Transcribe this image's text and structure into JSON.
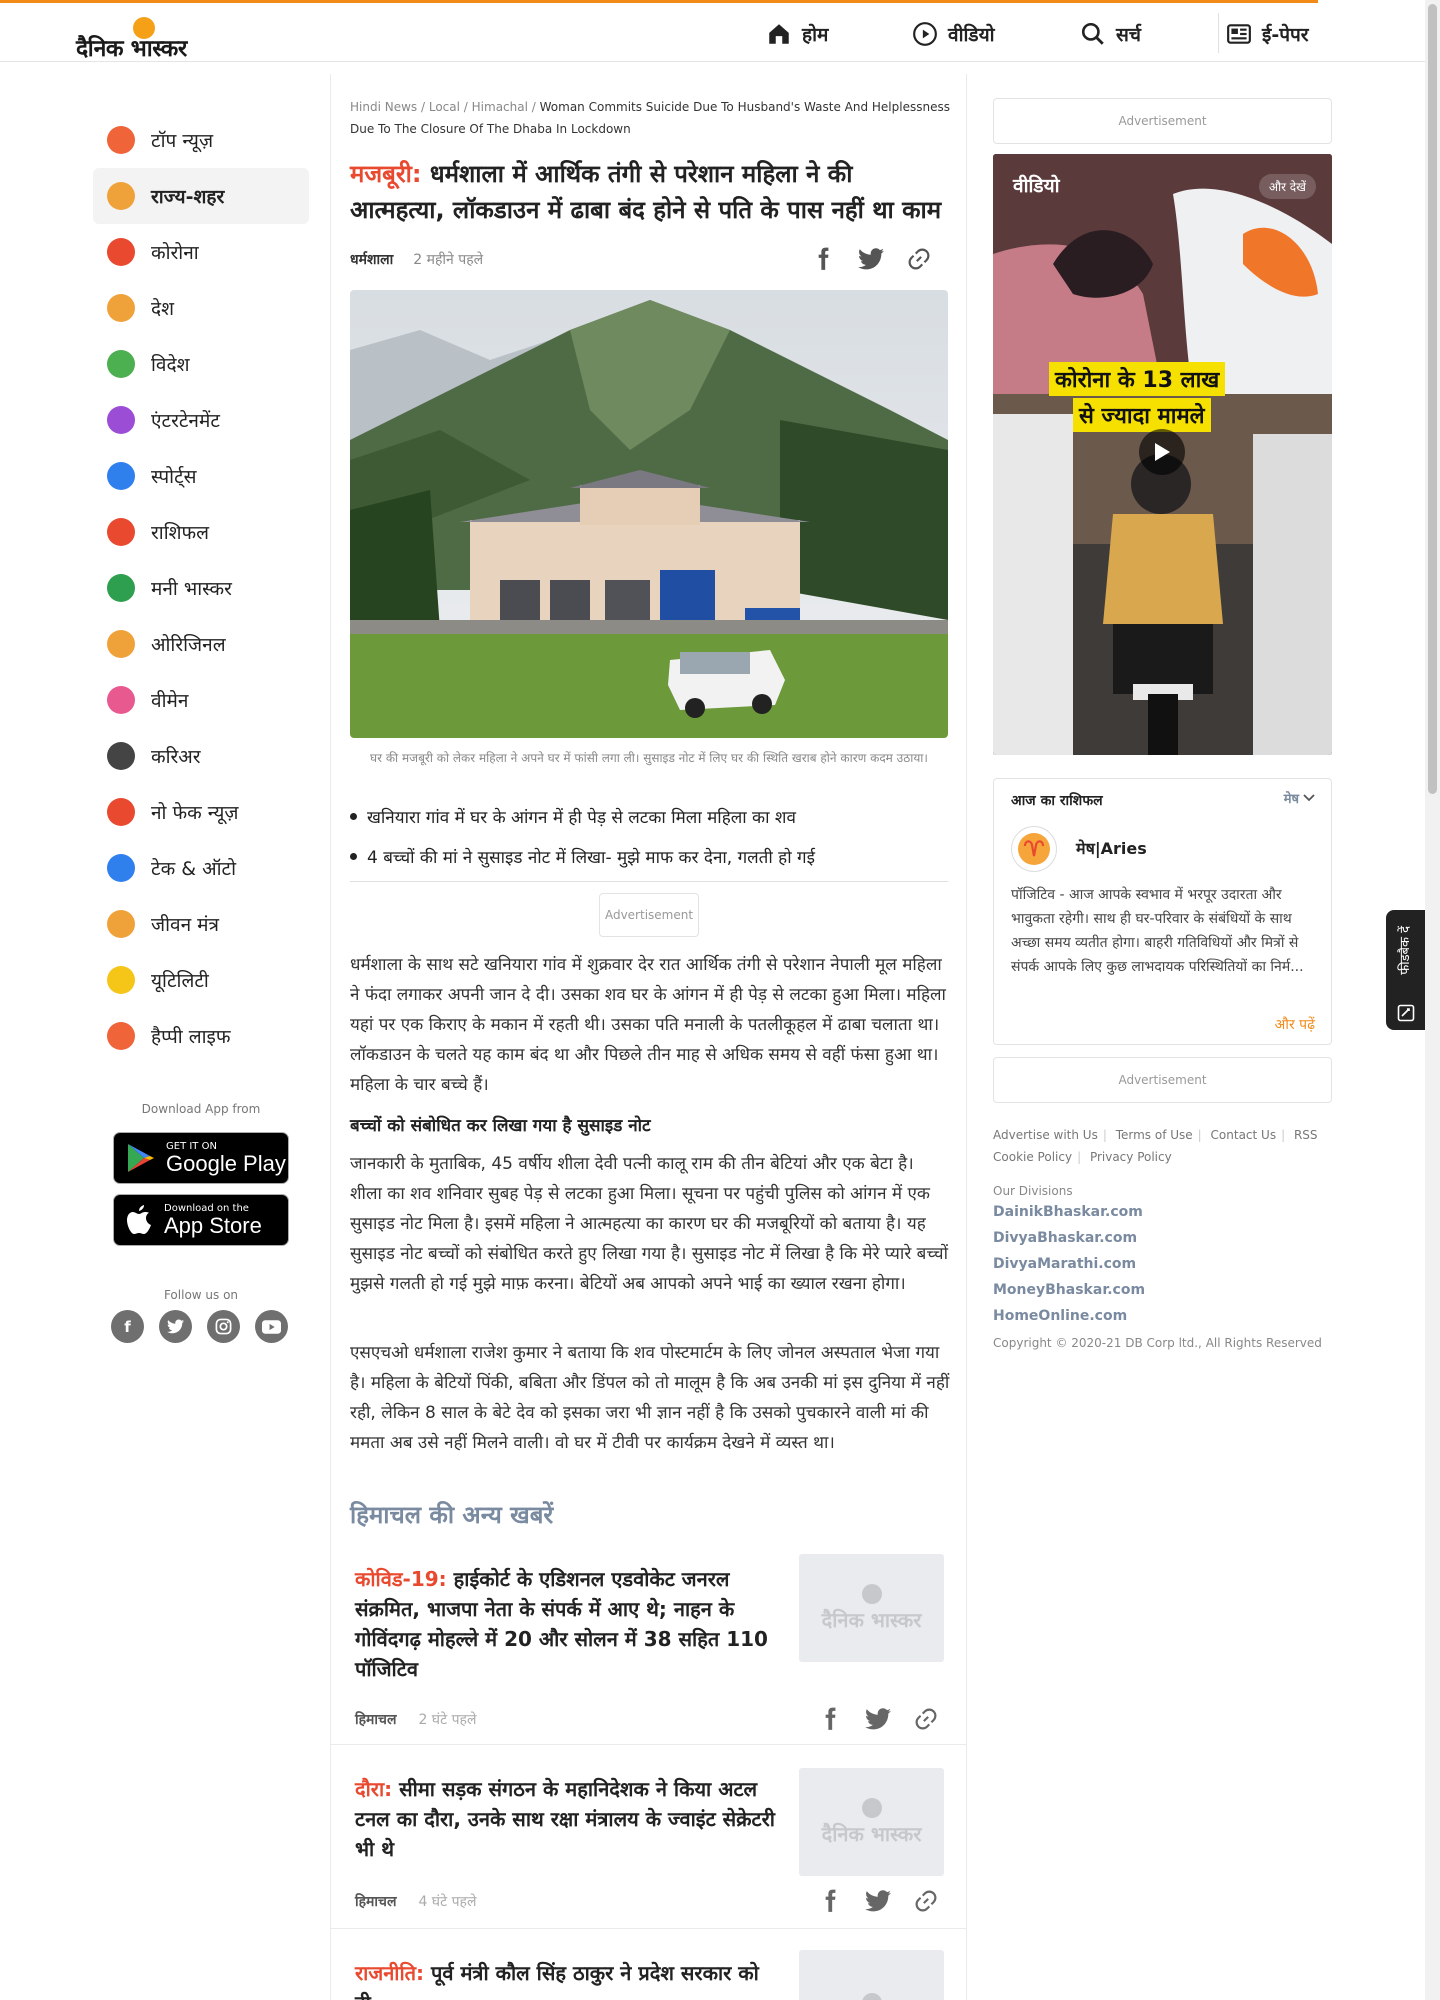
{
  "brand": {
    "logo_text": "दैनिक भास्कर"
  },
  "nav": [
    {
      "label": "होम",
      "icon": "home-icon"
    },
    {
      "label": "वीडियो",
      "icon": "play-icon"
    },
    {
      "label": "सर्च",
      "icon": "search-icon"
    },
    {
      "label": "ई-पेपर",
      "icon": "newspaper-icon"
    }
  ],
  "sidebar": {
    "items": [
      {
        "label": "टॉप न्यूज़",
        "icon": "flame-icon",
        "color": "#f0643a"
      },
      {
        "label": "राज्य-शहर",
        "icon": "city-icon",
        "color": "#f0a23a",
        "active": true
      },
      {
        "label": "कोरोना",
        "icon": "virus-icon",
        "color": "#e8492f"
      },
      {
        "label": "देश",
        "icon": "india-gate-icon",
        "color": "#f0a23a"
      },
      {
        "label": "विदेश",
        "icon": "globe-icon",
        "color": "#4caf50"
      },
      {
        "label": "एंटरटेनमेंट",
        "icon": "clapper-icon",
        "color": "#9c4dd6"
      },
      {
        "label": "स्पोर्ट्स",
        "icon": "runner-icon",
        "color": "#2f80ed"
      },
      {
        "label": "राशिफल",
        "icon": "zodiac-icon",
        "color": "#e8492f"
      },
      {
        "label": "मनी भास्कर",
        "icon": "rupee-icon",
        "color": "#2e9e4f"
      },
      {
        "label": "ओरिजिनल",
        "icon": "original-icon",
        "color": "#f0a23a"
      },
      {
        "label": "वीमेन",
        "icon": "women-icon",
        "color": "#e85a8f"
      },
      {
        "label": "करिअर",
        "icon": "graduation-cap-icon",
        "color": "#444444"
      },
      {
        "label": "नो फेक न्यूज़",
        "icon": "no-fake-icon",
        "color": "#e8492f"
      },
      {
        "label": "टेक & ऑटो",
        "icon": "tech-auto-icon",
        "color": "#2f80ed"
      },
      {
        "label": "जीवन मंत्र",
        "icon": "kalash-icon",
        "color": "#f0a23a"
      },
      {
        "label": "यूटिलिटी",
        "icon": "bulb-icon",
        "color": "#f5c518"
      },
      {
        "label": "हैप्पी लाइफ",
        "icon": "heart-hands-icon",
        "color": "#f0643a"
      }
    ],
    "download_label": "Download App from",
    "google_play": {
      "small": "GET IT ON",
      "big": "Google Play"
    },
    "app_store": {
      "small": "Download on the",
      "big": "App Store"
    },
    "follow_label": "Follow us on",
    "socials": [
      "facebook-icon",
      "twitter-icon",
      "instagram-icon",
      "youtube-icon"
    ]
  },
  "article": {
    "breadcrumb": [
      "Hindi News",
      "Local",
      "Himachal"
    ],
    "breadcrumb_current": "Woman Commits Suicide Due To Husband's Waste And Helplessness Due To The Closure Of The Dhaba In Lockdown",
    "kicker": "मजबूरी:",
    "headline": "धर्मशाला में आर्थिक तंगी से परेशान महिला ने की आत्महत्या, लॉकडाउन में ढाबा बंद होने से पति के पास नहीं था काम",
    "location": "धर्मशाला",
    "time": "2 महीने पहले",
    "caption": "घर की मजबूरी को लेकर महिला ने अपने घर में फांसी लगा ली। सुसाइड नोट में लिए घर की स्थिति खराब होने कारण कदम उठाया।",
    "bullets": [
      "खनियारा गांव में घर के आंगन में ही पेड़ से लटका मिला महिला का शव",
      "4 बच्चों की मां ने सुसाइड नोट में लिखा- मुझे माफ कर देना, गलती हो गई"
    ],
    "ad_label": "Advertisement",
    "paragraphs": [
      "धर्मशाला के साथ सटे खनियारा गांव में शुक्रवार देर रात आर्थिक तंगी से परेशान नेपाली मूल महिला ने फंदा लगाकर अपनी जान दे दी। उसका शव घर के आंगन में ही पेड़ से लटका हुआ मिला। महिला यहां पर एक किराए के मकान में रहती थी। उसका पति मनाली के पतलीकूहल में ढाबा चलाता था। लॉकडाउन के चलते यह काम बंद था और पिछले तीन माह से अधिक समय से वहीं फंसा हुआ था। महिला के चार बच्चे हैं।",
      "जानकारी के मुताबिक, 45 वर्षीय शीला देवी पत्नी कालू राम की तीन बेटियां और एक बेटा है। शीला का शव शनिवार सुबह पेड़ से लटका हुआ मिला। सूचना पर पहुंची पुलिस को आंगन में एक सुसाइड नोट मिला है। इसमें महिला ने आत्महत्या का कारण घर की मजबूरियों को बताया है। यह सुसाइड नोट बच्चों को संबोधित करते हुए लिखा गया है। सुसाइड नोट में लिखा है कि मेरे प्यारे बच्चों मुझसे गलती हो गई मुझे माफ़ करना। बेटियों अब आपको अपने भाई का ख्याल रखना होगा।",
      "एसएचओ धर्मशाला राजेश कुमार ने बताया कि शव पोस्टमार्टम के लिए जोनल अस्पताल भेजा गया है। महिला के बेटियों पिंकी, बबिता और डिंपल को तो मालूम है कि अब उनकी मां इस दुनिया में नहीं रही, लेकिन 8 साल के बेटे देव को इसका जरा भी ज्ञान नहीं है कि उसको पुचकारने वाली मां की ममता अब उसे नहीं मिलने वाली। वो घर में टीवी पर कार्यक्रम देखने में व्यस्त था।"
    ],
    "subhead": "बच्चों को संबोधित कर लिखा गया है सुसाइड नोट"
  },
  "more_news": {
    "title": "हिमाचल की अन्य खबरें",
    "thumb_text": "दैनिक भास्कर",
    "stories": [
      {
        "kicker": "कोविड-19:",
        "title": "हाईकोर्ट के एडिशनल एडवोकेट जनरल संक्रमित, भाजपा नेता के संपर्क में आए थे; नाहन के गोविंदगढ़ मोहल्ले में 20 और सोलन में 38 सहित 110 पॉजिटिव",
        "location": "हिमाचल",
        "time": "2 घंटे पहले"
      },
      {
        "kicker": "दौरा:",
        "title": "सीमा सड़क संगठन के महानिदेशक ने किया अटल टनल का दौरा, उनके साथ रक्षा मंत्रालय के ज्वाइंट सेक्रेटरी भी थे",
        "location": "हिमाचल",
        "time": "4 घंटे पहले"
      },
      {
        "kicker": "राजनीति:",
        "title": "पूर्व मंत्री कौल सिंह ठाकुर ने प्रदेश सरकार को दी",
        "location": "",
        "time": ""
      }
    ]
  },
  "right_rail": {
    "ad_label": "Advertisement",
    "video": {
      "label": "वीडियो",
      "more": "और देखें",
      "overlay_line1": "कोरोना के 13 लाख",
      "overlay_line2": "से ज्यादा मामले"
    },
    "rashifal": {
      "title": "आज का राशिफल",
      "selected_sign": "मेष",
      "sign_name": "मेष|Aries",
      "text": "पॉजिटिव - आज आपके स्वभाव में भरपूर उदारता और भावुकता रहेगी। साथ ही घर-परिवार के संबंधियों के साथ अच्छा समय व्यतीत होगा। बाहरी गतिविधियों और मित्रों से संपर्क आपके लिए कुछ लाभदायक परिस्थितियों का निर्म...",
      "read_more": "और पढ़ें"
    },
    "footer_links": [
      "Advertise with Us",
      "Terms of Use",
      "Contact Us",
      "RSS",
      "Cookie Policy",
      "Privacy Policy"
    ],
    "divisions_label": "Our Divisions",
    "divisions": [
      "DainikBhaskar.com",
      "DivyaBhaskar.com",
      "DivyaMarathi.com",
      "MoneyBhaskar.com",
      "HomeOnline.com"
    ],
    "copyright": "Copyright © 2020-21 DB Corp ltd., All Rights Reserved"
  },
  "feedback_label": "फीडबैक दें",
  "colors": {
    "accent": "#f28a18",
    "kicker": "#e8492f",
    "muted_blue": "#7a8aa0"
  }
}
